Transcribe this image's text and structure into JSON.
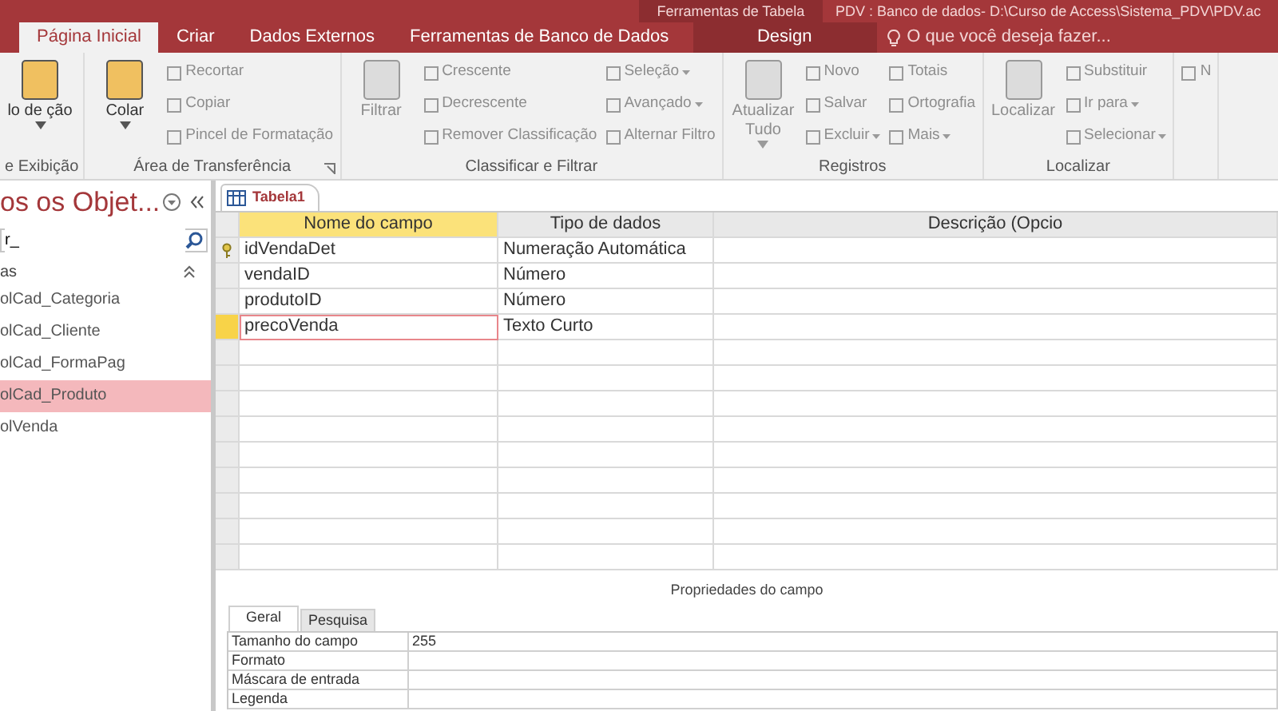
{
  "title_bar": {
    "context_label": "Ferramentas de Tabela",
    "title": "PDV : Banco de dados- D:\\Curso de Access\\Sistema_PDV\\PDV.ac"
  },
  "tabs": [
    {
      "label": "Página Inicial",
      "selected": true,
      "contextual": false
    },
    {
      "label": "Criar",
      "selected": false,
      "contextual": false
    },
    {
      "label": "Dados Externos",
      "selected": false,
      "contextual": false
    },
    {
      "label": "Ferramentas de Banco de Dados",
      "selected": false,
      "contextual": false
    },
    {
      "label": "Design",
      "selected": false,
      "contextual": true
    }
  ],
  "tell_me": {
    "placeholder": "O que você deseja fazer..."
  },
  "ribbon": {
    "groups": [
      {
        "label": "e Exibição",
        "launcher": false,
        "columns": [
          [
            {
              "label": "lo de ção",
              "kind": "large",
              "disabled": false,
              "dropdown": true
            }
          ]
        ]
      },
      {
        "label": "Área de Transferência",
        "launcher": true,
        "columns": [
          [
            {
              "label": "Colar",
              "kind": "large",
              "disabled": false,
              "dropdown": true
            }
          ],
          [
            {
              "label": "Recortar",
              "kind": "small",
              "disabled": true,
              "dropdown": false
            },
            {
              "label": "Copiar",
              "kind": "small",
              "disabled": true,
              "dropdown": false
            },
            {
              "label": "Pincel de Formatação",
              "kind": "small",
              "disabled": true,
              "dropdown": false
            }
          ]
        ]
      },
      {
        "label": "Classificar e Filtrar",
        "launcher": false,
        "columns": [
          [
            {
              "label": "Filtrar",
              "kind": "large",
              "disabled": true,
              "dropdown": false
            }
          ],
          [
            {
              "label": "Crescente",
              "kind": "small",
              "disabled": true,
              "dropdown": false
            },
            {
              "label": "Decrescente",
              "kind": "small",
              "disabled": true,
              "dropdown": false
            },
            {
              "label": "Remover Classificação",
              "kind": "small",
              "disabled": true,
              "dropdown": false
            }
          ],
          [
            {
              "label": "Seleção",
              "kind": "small",
              "disabled": true,
              "dropdown": true
            },
            {
              "label": "Avançado",
              "kind": "small",
              "disabled": true,
              "dropdown": true
            },
            {
              "label": "Alternar Filtro",
              "kind": "small",
              "disabled": true,
              "dropdown": false
            }
          ]
        ]
      },
      {
        "label": "Registros",
        "launcher": false,
        "columns": [
          [
            {
              "label": "Atualizar Tudo",
              "kind": "large",
              "disabled": true,
              "dropdown": true
            }
          ],
          [
            {
              "label": "Novo",
              "kind": "small",
              "disabled": true,
              "dropdown": false
            },
            {
              "label": "Salvar",
              "kind": "small",
              "disabled": true,
              "dropdown": false
            },
            {
              "label": "Excluir",
              "kind": "small",
              "disabled": true,
              "dropdown": true
            }
          ],
          [
            {
              "label": "Totais",
              "kind": "small",
              "disabled": true,
              "dropdown": false
            },
            {
              "label": "Ortografia",
              "kind": "small",
              "disabled": true,
              "dropdown": false
            },
            {
              "label": "Mais",
              "kind": "small",
              "disabled": true,
              "dropdown": true
            }
          ]
        ]
      },
      {
        "label": "Localizar",
        "launcher": false,
        "columns": [
          [
            {
              "label": "Localizar",
              "kind": "large",
              "disabled": true,
              "dropdown": false
            }
          ],
          [
            {
              "label": "Substituir",
              "kind": "small",
              "disabled": true,
              "dropdown": false
            },
            {
              "label": "Ir para",
              "kind": "small",
              "disabled": true,
              "dropdown": true
            },
            {
              "label": "Selecionar",
              "kind": "small",
              "disabled": true,
              "dropdown": true
            }
          ]
        ]
      },
      {
        "launcher": false,
        "columns": [
          [
            {
              "label": "N",
              "kind": "small",
              "disabled": true,
              "dropdown": false
            }
          ]
        ]
      }
    ]
  },
  "navigation_pane": {
    "title": "os os Objet...",
    "search": {
      "value": "r_"
    },
    "section": "as",
    "items": [
      {
        "label": "olCad_Categoria",
        "selected": false
      },
      {
        "label": "olCad_Cliente",
        "selected": false
      },
      {
        "label": "olCad_FormaPag",
        "selected": false
      },
      {
        "label": "olCad_Produto",
        "selected": true
      },
      {
        "label": "olVenda",
        "selected": false
      }
    ]
  },
  "document_tab": {
    "label": "Tabela1"
  },
  "design_grid": {
    "columns": [
      "Nome do campo",
      "Tipo de dados",
      "Descrição (Opcio"
    ],
    "rows": [
      {
        "field_name": "idVendaDet",
        "data_type": "Numeração Automática",
        "primary_key": true,
        "selected": false
      },
      {
        "field_name": "vendaID",
        "data_type": "Número",
        "primary_key": false,
        "selected": false
      },
      {
        "field_name": "produtoID",
        "data_type": "Número",
        "primary_key": false,
        "selected": false
      },
      {
        "field_name": "precoVenda",
        "data_type": "Texto Curto",
        "primary_key": false,
        "selected": true
      }
    ]
  },
  "field_properties": {
    "title": "Propriedades do campo",
    "tabs": [
      {
        "label": "Geral",
        "selected": true
      },
      {
        "label": "Pesquisa",
        "selected": false
      }
    ],
    "rows": [
      {
        "label": "Tamanho do campo",
        "value": "255"
      },
      {
        "label": "Formato"
      },
      {
        "label": "Máscara de entrada"
      },
      {
        "label": "Legenda"
      }
    ]
  }
}
